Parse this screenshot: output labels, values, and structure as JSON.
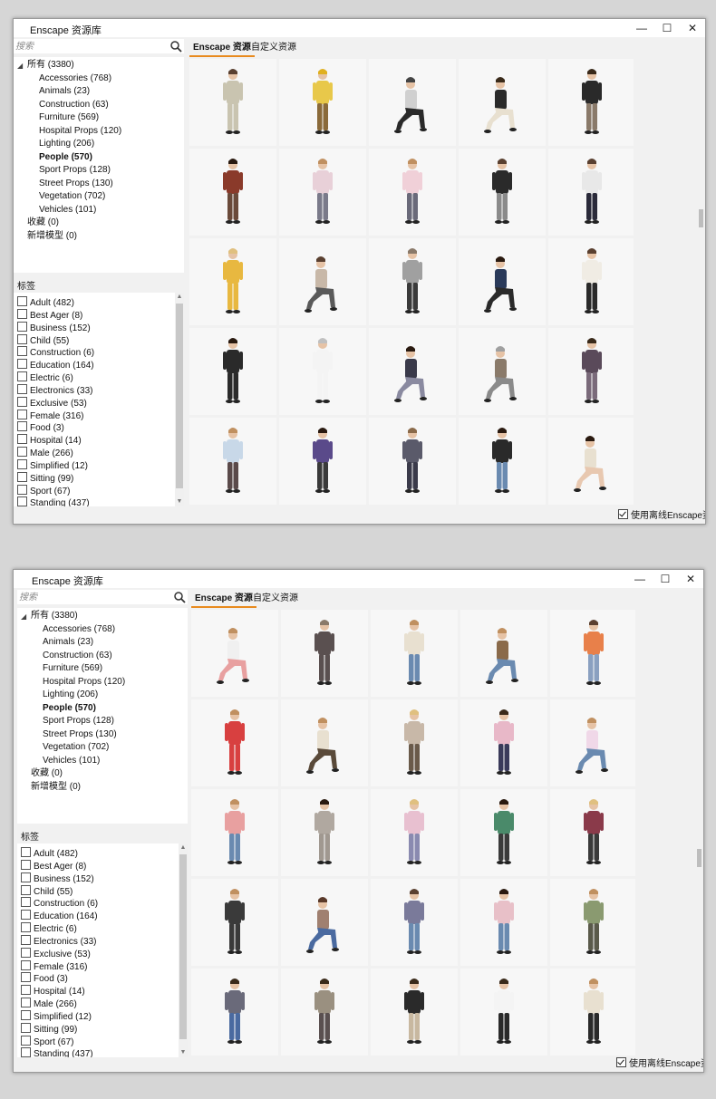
{
  "windows": [
    {
      "title": "Enscape 资源库",
      "controls": {
        "minimize": "—",
        "maximize": "☐",
        "close": "✕"
      },
      "search": {
        "placeholder": "搜索"
      },
      "tree": {
        "root": "所有 (3380)",
        "children": [
          "Accessories (768)",
          "Animals (23)",
          "Construction (63)",
          "Furniture (569)",
          "Hospital Props (120)",
          "Lighting (206)",
          "People (570)",
          "Sport Props (128)",
          "Street Props (130)",
          "Vegetation (702)",
          "Vehicles (101)"
        ],
        "selected": "People (570)",
        "extra": [
          "收藏 (0)",
          "新增模型 (0)"
        ]
      },
      "tags_header": "标签",
      "tags": [
        "Adult (482)",
        "Best Ager (8)",
        "Business (152)",
        "Child (55)",
        "Construction (6)",
        "Education (164)",
        "Electric (6)",
        "Electronics (33)",
        "Exclusive (53)",
        "Female (316)",
        "Food (3)",
        "Hospital (14)",
        "Male (266)",
        "Simplified (12)",
        "Sitting (99)",
        "Sport (67)",
        "Standing (437)"
      ],
      "tabs": [
        {
          "label": "Enscape 资源",
          "active": true
        },
        {
          "label": "自定义资源",
          "active": false
        }
      ],
      "offline_checkbox": {
        "label": "使用离线Enscape资源",
        "checked": true
      },
      "thumbnails": [
        {
          "shirt": "#c9c4b0",
          "pants": "#c9c4b0",
          "hair": "#5a4030",
          "pose": "stand"
        },
        {
          "shirt": "#e8c84a",
          "pants": "#8a6a3a",
          "hair": "#e0b020",
          "pose": "stand"
        },
        {
          "shirt": "#d0d0d0",
          "pants": "#2a2a2a",
          "hair": "#444444",
          "pose": "sit"
        },
        {
          "shirt": "#2a2a2a",
          "pants": "#e8e0d0",
          "hair": "#3a2a1a",
          "pose": "sit"
        },
        {
          "shirt": "#2a2a2a",
          "pants": "#8a7a6a",
          "hair": "#3a2a1a",
          "pose": "stand"
        },
        {
          "shirt": "#8a3a2a",
          "pants": "#6a4a3a",
          "hair": "#2a1a10",
          "pose": "stand"
        },
        {
          "shirt": "#e8d0d8",
          "pants": "#7a7a8a",
          "hair": "#c09060",
          "pose": "stand"
        },
        {
          "shirt": "#f0d0d8",
          "pants": "#6a6a7a",
          "hair": "#c09060",
          "pose": "stand"
        },
        {
          "shirt": "#2a2a2a",
          "pants": "#8a8a8a",
          "hair": "#5a4030",
          "pose": "stand"
        },
        {
          "shirt": "#e8e8e8",
          "pants": "#2a2a3a",
          "hair": "#5a4030",
          "pose": "stand"
        },
        {
          "shirt": "#e8b840",
          "pants": "#e8b840",
          "hair": "#e0c080",
          "pose": "stand"
        },
        {
          "shirt": "#c8b8a8",
          "pants": "#5a5a5a",
          "hair": "#5a4030",
          "pose": "sit"
        },
        {
          "shirt": "#a0a0a0",
          "pants": "#3a3a3a",
          "hair": "#8a7a6a",
          "pose": "stand"
        },
        {
          "shirt": "#2a3a5a",
          "pants": "#2a2a2a",
          "hair": "#2a1a10",
          "pose": "sit"
        },
        {
          "shirt": "#f0ece4",
          "pants": "#2a2a2a",
          "hair": "#5a4030",
          "pose": "stand"
        },
        {
          "shirt": "#2a2a2a",
          "pants": "#2a2a2a",
          "hair": "#2a1a10",
          "pose": "stand"
        },
        {
          "shirt": "#f4f4f4",
          "pants": "#f4f4f4",
          "hair": "#c0c0c0",
          "pose": "stand"
        },
        {
          "shirt": "#3a3a4a",
          "pants": "#8a8aa0",
          "hair": "#2a1a10",
          "pose": "sit"
        },
        {
          "shirt": "#8a7a6a",
          "pants": "#8a8a8a",
          "hair": "#a0a0a0",
          "pose": "sit"
        },
        {
          "shirt": "#5a4a5a",
          "pants": "#7a6a7a",
          "hair": "#3a2a1a",
          "pose": "stand"
        },
        {
          "shirt": "#c8d8e8",
          "pants": "#5a4a4a",
          "hair": "#c09060",
          "pose": "stand"
        },
        {
          "shirt": "#5a4a8a",
          "pants": "#3a3a3a",
          "hair": "#2a1a10",
          "pose": "stand"
        },
        {
          "shirt": "#5a5a6a",
          "pants": "#3a3a4a",
          "hair": "#8a6a4a",
          "pose": "stand"
        },
        {
          "shirt": "#2a2a2a",
          "pants": "#6a8ab0",
          "hair": "#2a1a10",
          "pose": "stand"
        },
        {
          "shirt": "#e8e0d0",
          "pants": "#e8c8b0",
          "hair": "#2a1a10",
          "pose": "sit"
        }
      ]
    },
    {
      "title": "Enscape 资源库",
      "controls": {
        "minimize": "—",
        "maximize": "☐",
        "close": "✕"
      },
      "search": {
        "placeholder": "搜索"
      },
      "tree": {
        "root": "所有 (3380)",
        "children": [
          "Accessories (768)",
          "Animals (23)",
          "Construction (63)",
          "Furniture (569)",
          "Hospital Props (120)",
          "Lighting (206)",
          "People (570)",
          "Sport Props (128)",
          "Street Props (130)",
          "Vegetation (702)",
          "Vehicles (101)"
        ],
        "selected": "People (570)",
        "extra": [
          "收藏 (0)",
          "新增模型 (0)"
        ]
      },
      "tags_header": "标签",
      "tags": [
        "Adult (482)",
        "Best Ager (8)",
        "Business (152)",
        "Child (55)",
        "Construction (6)",
        "Education (164)",
        "Electric (6)",
        "Electronics (33)",
        "Exclusive (53)",
        "Female (316)",
        "Food (3)",
        "Hospital (14)",
        "Male (266)",
        "Simplified (12)",
        "Sitting (99)",
        "Sport (67)",
        "Standing (437)"
      ],
      "tabs": [
        {
          "label": "Enscape 资源",
          "active": true
        },
        {
          "label": "自定义资源",
          "active": false
        }
      ],
      "offline_checkbox": {
        "label": "使用离线Enscape资源",
        "checked": true
      },
      "thumbnails": [
        {
          "shirt": "#f0f0f0",
          "pants": "#e8a0a0",
          "hair": "#c09060",
          "pose": "sit"
        },
        {
          "shirt": "#5a5050",
          "pants": "#5a5050",
          "hair": "#8a7a6a",
          "pose": "stand"
        },
        {
          "shirt": "#e8e0d0",
          "pants": "#6a8ab0",
          "hair": "#c09060",
          "pose": "stand"
        },
        {
          "shirt": "#8a6a4a",
          "pants": "#6a8ab0",
          "hair": "#c09060",
          "pose": "sit"
        },
        {
          "shirt": "#e8804a",
          "pants": "#8aa0c0",
          "hair": "#5a4030",
          "pose": "stand"
        },
        {
          "shirt": "#d84040",
          "pants": "#d84040",
          "hair": "#c09060",
          "pose": "stand"
        },
        {
          "shirt": "#e8e0d0",
          "pants": "#5a4a3a",
          "hair": "#c09060",
          "pose": "sit"
        },
        {
          "shirt": "#c8b8a8",
          "pants": "#6a5a4a",
          "hair": "#e0c080",
          "pose": "stand"
        },
        {
          "shirt": "#e8b8c8",
          "pants": "#3a3a5a",
          "hair": "#3a2a1a",
          "pose": "stand"
        },
        {
          "shirt": "#f0d8e8",
          "pants": "#6a8ab0",
          "hair": "#c09060",
          "pose": "sit"
        },
        {
          "shirt": "#e8a0a0",
          "pants": "#6a8ab0",
          "hair": "#c09060",
          "pose": "stand"
        },
        {
          "shirt": "#b0a8a0",
          "pants": "#a09890",
          "hair": "#2a1a10",
          "pose": "stand"
        },
        {
          "shirt": "#e8c0d0",
          "pants": "#8a8ab0",
          "hair": "#e0c080",
          "pose": "stand"
        },
        {
          "shirt": "#4a8a6a",
          "pants": "#3a3a3a",
          "hair": "#2a1a10",
          "pose": "stand"
        },
        {
          "shirt": "#8a3a4a",
          "pants": "#3a3a3a",
          "hair": "#e0c080",
          "pose": "stand"
        },
        {
          "shirt": "#3a3a3a",
          "pants": "#3a3a3a",
          "hair": "#c09060",
          "pose": "stand"
        },
        {
          "shirt": "#a08070",
          "pants": "#4a6aa0",
          "hair": "#5a3a2a",
          "pose": "sit"
        },
        {
          "shirt": "#7a7a9a",
          "pants": "#6a8ab0",
          "hair": "#5a4030",
          "pose": "stand"
        },
        {
          "shirt": "#e8c0c8",
          "pants": "#6a8ab0",
          "hair": "#2a1a10",
          "pose": "stand"
        },
        {
          "shirt": "#8a9a70",
          "pants": "#5a5a4a",
          "hair": "#c09060",
          "pose": "stand"
        },
        {
          "shirt": "#6a6a7a",
          "pants": "#4a6aa0",
          "hair": "#3a2a1a",
          "pose": "stand"
        },
        {
          "shirt": "#9a9080",
          "pants": "#5a5050",
          "hair": "#3a2a1a",
          "pose": "stand"
        },
        {
          "shirt": "#2a2a2a",
          "pants": "#c8b8a0",
          "hair": "#3a2a1a",
          "pose": "stand"
        },
        {
          "shirt": "#f4f4f4",
          "pants": "#2a2a2a",
          "hair": "#3a2a1a",
          "pose": "stand"
        },
        {
          "shirt": "#e8e0d0",
          "pants": "#2a2a2a",
          "hair": "#c09060",
          "pose": "stand"
        }
      ]
    }
  ]
}
